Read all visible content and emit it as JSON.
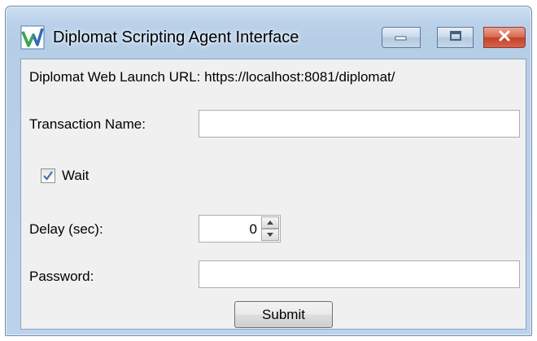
{
  "window": {
    "title": "Diplomat Scripting Agent Interface",
    "icon": "diplomat-app-icon",
    "controls": {
      "minimize_icon": "minimize-icon",
      "maximize_icon": "maximize-icon",
      "close_icon": "close-icon"
    }
  },
  "form": {
    "launch_url_text": "Diplomat Web Launch URL: https://localhost:8081/diplomat/",
    "transaction_name": {
      "label": "Transaction Name:",
      "value": ""
    },
    "wait": {
      "label": "Wait",
      "checked": true
    },
    "delay": {
      "label": "Delay (sec):",
      "value": "0"
    },
    "password": {
      "label": "Password:",
      "value": ""
    },
    "submit_label": "Submit"
  },
  "colors": {
    "frame": "#bcd3eb",
    "client_background": "#f0f0f0",
    "close_button": "#c3402a",
    "icon_green": "#39a64a",
    "icon_blue": "#2f6bb3"
  }
}
